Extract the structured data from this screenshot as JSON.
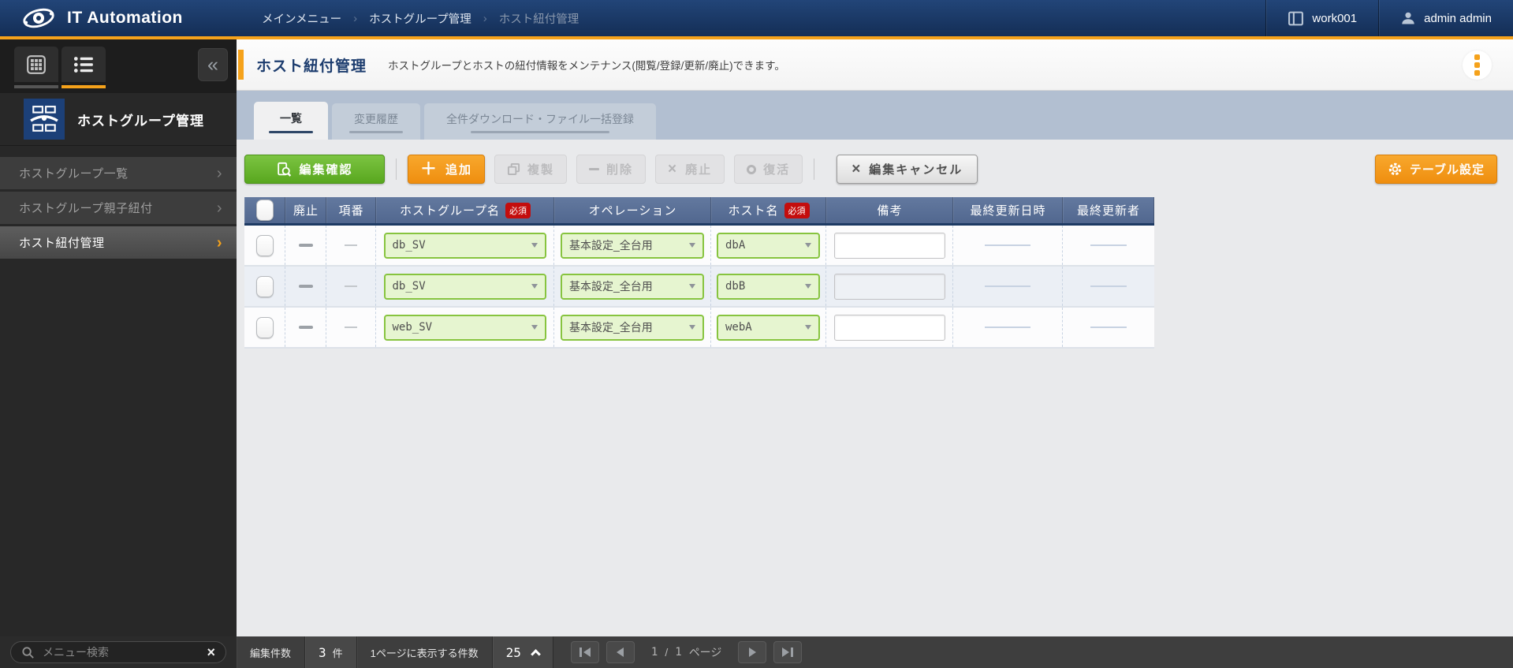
{
  "colors": {
    "accent_orange": "#F5A21B",
    "brand_navy": "#1A3763",
    "button_green": "#58A71F",
    "table_header_blue": "#57709B",
    "select_green_border": "#87C43F",
    "required_red": "#C40D0D"
  },
  "header": {
    "app_title": "IT Automation",
    "breadcrumb": [
      "メインメニュー",
      "ホストグループ管理",
      "ホスト紐付管理"
    ],
    "workspace": "work001",
    "user": "admin admin"
  },
  "sidebar": {
    "panel_title": "ホストグループ管理",
    "collapse_glyph": "«",
    "items": [
      {
        "label": "ホストグループ一覧"
      },
      {
        "label": "ホストグループ親子紐付"
      },
      {
        "label": "ホスト紐付管理"
      }
    ],
    "search_placeholder": "メニュー検索"
  },
  "page": {
    "title": "ホスト紐付管理",
    "description": "ホストグループとホストの紐付情報をメンテナンス(閲覧/登録/更新/廃止)できます。",
    "tabs": [
      {
        "label": "一覧"
      },
      {
        "label": "変更履歴"
      },
      {
        "label": "全件ダウンロード・ファイル一括登録"
      }
    ],
    "toolbar": {
      "edit_confirm": "編集確認",
      "add": "追加",
      "duplicate": "複製",
      "delete": "削除",
      "discard": "廃止",
      "restore": "復活",
      "edit_cancel": "編集キャンセル",
      "table_config": "テーブル設定"
    },
    "table": {
      "required_badge": "必須",
      "columns": [
        {
          "label": ""
        },
        {
          "label": "廃止"
        },
        {
          "label": "項番"
        },
        {
          "label": "ホストグループ名",
          "required": true
        },
        {
          "label": "オペレーション"
        },
        {
          "label": "ホスト名",
          "required": true
        },
        {
          "label": "備考"
        },
        {
          "label": "最終更新日時"
        },
        {
          "label": "最終更新者"
        }
      ],
      "rows": [
        {
          "host_group": "db_SV",
          "operation": "基本設定_全台用",
          "host": "dbA",
          "note": ""
        },
        {
          "host_group": "db_SV",
          "operation": "基本設定_全台用",
          "host": "dbB",
          "note": ""
        },
        {
          "host_group": "web_SV",
          "operation": "基本設定_全台用",
          "host": "webA",
          "note": ""
        }
      ]
    },
    "footer": {
      "edit_count_label": "編集件数",
      "edit_count": "3",
      "edit_count_unit": "件",
      "per_page_label": "1ページに表示する件数",
      "per_page": "25",
      "page_current": "1",
      "page_separator": "/",
      "page_total": "1",
      "page_unit": "ページ"
    }
  }
}
